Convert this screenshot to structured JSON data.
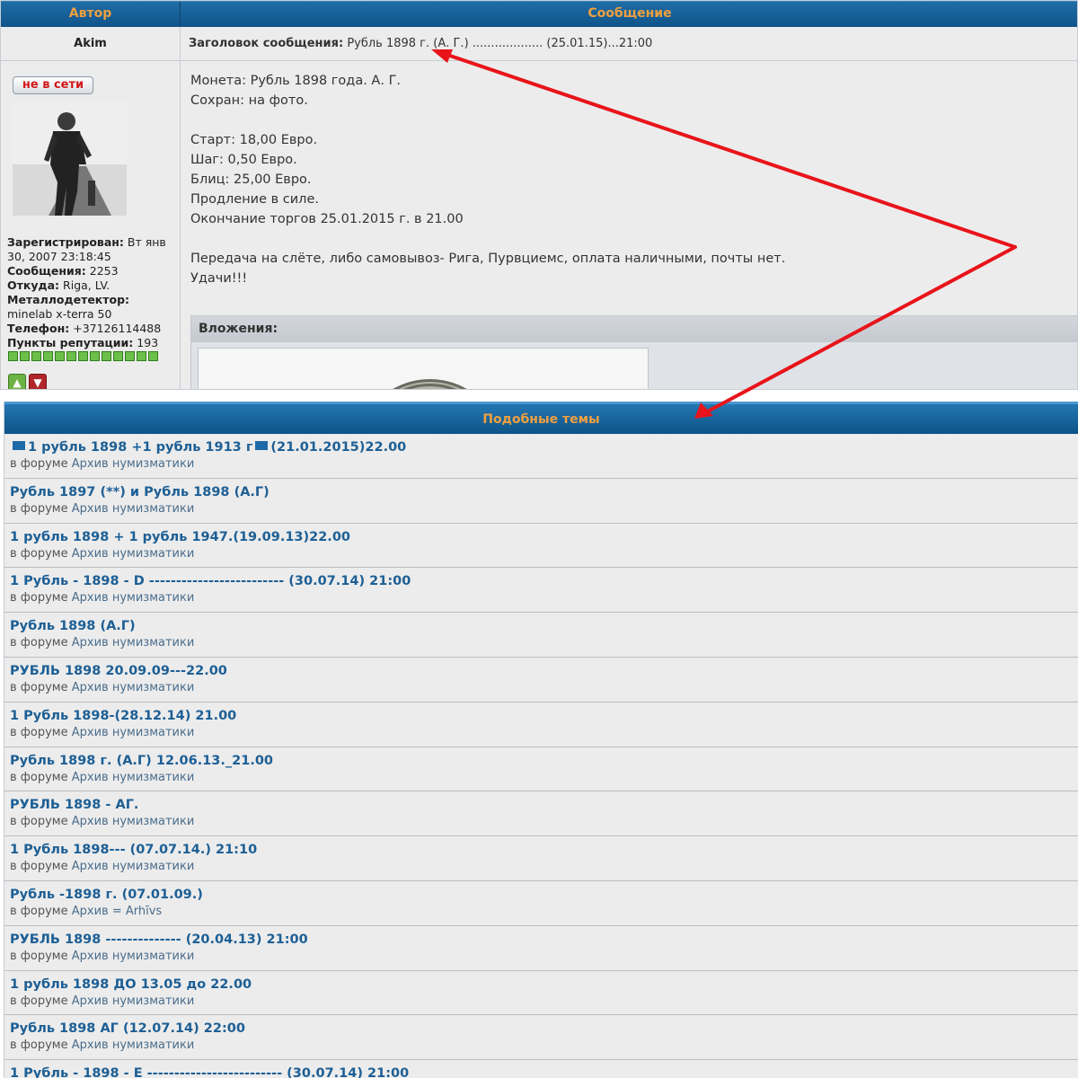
{
  "post": {
    "header": {
      "author_col": "Автор",
      "message_col": "Сообщение"
    },
    "author_name": "Akim",
    "subject": {
      "label": "Заголовок сообщения:",
      "text": "Рубль 1898 г. (А. Г.) ................... (25.01.15)...21:00"
    },
    "profile": {
      "status_badge": "не в сети",
      "registered_label": "Зарегистрирован:",
      "registered_value": "Вт янв 30, 2007 23:18:45",
      "posts_label": "Сообщения:",
      "posts_value": "2253",
      "from_label": "Откуда:",
      "from_value": "Riga, LV.",
      "detector_label": "Металлодетектор:",
      "detector_value": "minelab x-terra 50",
      "phone_label": "Телефон:",
      "phone_value": "+37126114488",
      "rep_label": "Пункты репутации:",
      "rep_value": "193",
      "rep_level": 13
    },
    "message_lines": [
      "Монета: Рубль 1898 года. А. Г.",
      "Сохран: на фото.",
      "",
      "Старт: 18,00 Евро.",
      "Шаг: 0,50 Евро.",
      "Блиц: 25,00 Евро.",
      "Продление в силе.",
      "Окончание торгов 25.01.2015 г. в 21.00",
      "",
      "Передача на слёте, либо самовывоз- Рига, Пурвциемс, оплата наличными, почты нет.",
      "Удачи!!!"
    ],
    "attachments_label": "Вложения:"
  },
  "similar": {
    "title": "Подобные темы",
    "topics": [
      {
        "title_a": "1 рубль 1898 +1 рубль 1913 г",
        "title_b": "(21.01.2015)22.00",
        "flags": true,
        "forum_prefix": "в форуме",
        "forum": "Архив нумизматики"
      },
      {
        "title": "Рубль 1897 (**) и Рубль 1898 (А.Г)",
        "forum_prefix": "в форуме",
        "forum": "Архив нумизматики"
      },
      {
        "title": "1 рубль 1898 + 1 рубль 1947.(19.09.13)22.00",
        "forum_prefix": "в форуме",
        "forum": "Архив нумизматики"
      },
      {
        "title": "1 Рубль - 1898 - D ------------------------- (30.07.14) 21:00",
        "forum_prefix": "в форуме",
        "forum": "Архив нумизматики"
      },
      {
        "title": "Рубль 1898 (А.Г)",
        "forum_prefix": "в форуме",
        "forum": "Архив нумизматики"
      },
      {
        "title": "РУБЛЬ 1898 20.09.09---22.00",
        "forum_prefix": "в форуме",
        "forum": "Архив нумизматики"
      },
      {
        "title": "1 Рубль 1898-(28.12.14) 21.00",
        "forum_prefix": "в форуме",
        "forum": "Архив нумизматики"
      },
      {
        "title": "Рубль 1898 г. (А.Г) 12.06.13._21.00",
        "forum_prefix": "в форуме",
        "forum": "Архив нумизматики"
      },
      {
        "title": "РУБЛЬ 1898 - АГ.",
        "forum_prefix": "в форуме",
        "forum": "Архив нумизматики"
      },
      {
        "title": "1 Рубль 1898--- (07.07.14.) 21:10",
        "forum_prefix": "в форуме",
        "forum": "Архив нумизматики"
      },
      {
        "title": "Рубль -1898 г. (07.01.09.)",
        "forum_prefix": "в форуме",
        "forum": "Архив = Arhīvs"
      },
      {
        "title": "РУБЛЬ 1898 -------------- (20.04.13) 21:00",
        "forum_prefix": "в форуме",
        "forum": "Архив нумизматики"
      },
      {
        "title": "1 рубль 1898 ДО 13.05 до 22.00",
        "forum_prefix": "в форуме",
        "forum": "Архив нумизматики"
      },
      {
        "title": "Рубль 1898 АГ (12.07.14) 22:00",
        "forum_prefix": "в форуме",
        "forum": "Архив нумизматики"
      },
      {
        "title": "1 Рубль - 1898 - E ------------------------- (30.07.14) 21:00",
        "forum_prefix": "в форуме",
        "forum": "Архив нумизматики"
      }
    ]
  },
  "colors": {
    "arrow": "#e8141a",
    "header_bg": "#155d94",
    "header_text": "#f0a040",
    "link": "#1d5f95"
  }
}
